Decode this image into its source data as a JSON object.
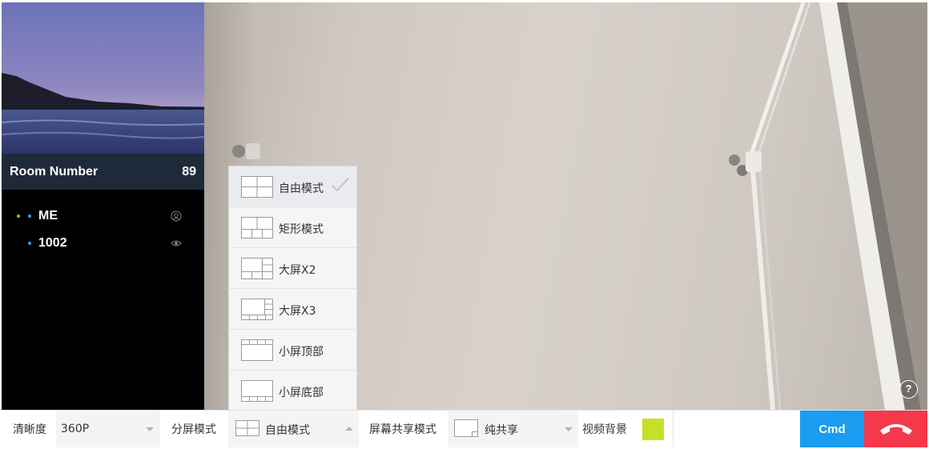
{
  "room": {
    "label": "Room Number",
    "number": "89"
  },
  "participants": [
    {
      "name": "ME",
      "dots": [
        "#6ad23a",
        "#27a1f0"
      ],
      "icon": "user-icon"
    },
    {
      "name": "1002",
      "dots": [
        "#27a1f0"
      ],
      "icon": "eye-icon"
    }
  ],
  "split_menu": {
    "items": [
      {
        "label": "自由模式",
        "icon": "layout-free-icon",
        "selected": true
      },
      {
        "label": "矩形模式",
        "icon": "layout-grid-icon",
        "selected": false
      },
      {
        "label": "大屏X2",
        "icon": "layout-big-x2-icon",
        "selected": false
      },
      {
        "label": "大屏X3",
        "icon": "layout-big-x3-icon",
        "selected": false
      },
      {
        "label": "小屏顶部",
        "icon": "layout-small-top-icon",
        "selected": false
      },
      {
        "label": "小屏底部",
        "icon": "layout-small-bottom-icon",
        "selected": false
      }
    ]
  },
  "toolbar": {
    "clarity_label": "清晰度",
    "clarity_value": "360P",
    "split_label": "分屏模式",
    "split_value": "自由模式",
    "share_label": "屏幕共享模式",
    "share_value": "纯共享",
    "bg_label": "视频背景",
    "bg_color": "#c6e027",
    "cmd_label": "Cmd"
  },
  "help_label": "?",
  "colors": {
    "accent_blue": "#1a9df0",
    "hangup_red": "#f5384a",
    "room_header_bg": "#1e2a3a"
  }
}
